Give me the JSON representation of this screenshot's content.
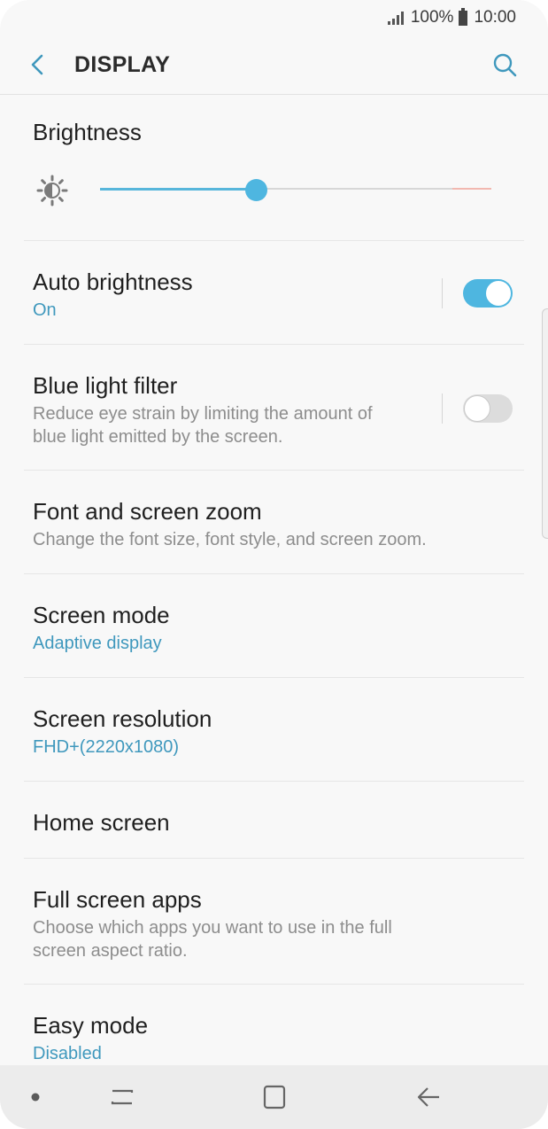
{
  "status_bar": {
    "battery_percent": "100%",
    "time": "10:00"
  },
  "header": {
    "title": "DISPLAY"
  },
  "brightness": {
    "title": "Brightness",
    "level": 0.4
  },
  "settings": {
    "auto_brightness": {
      "title": "Auto brightness",
      "value": "On",
      "enabled": true
    },
    "blue_light_filter": {
      "title": "Blue light filter",
      "description_line1": "Reduce eye strain by limiting the amount of",
      "description_line2": "blue light emitted by the screen.",
      "enabled": false
    },
    "font_zoom": {
      "title": "Font and screen zoom",
      "description": "Change the font size, font style, and screen zoom."
    },
    "screen_mode": {
      "title": "Screen mode",
      "value": "Adaptive display"
    },
    "screen_resolution": {
      "title": "Screen resolution",
      "value": "FHD+(2220x1080)"
    },
    "home_screen": {
      "title": "Home screen"
    },
    "full_screen_apps": {
      "title": "Full screen apps",
      "description_line1": "Choose which apps you want to use in the full",
      "description_line2": "screen aspect ratio."
    },
    "easy_mode": {
      "title": "Easy mode",
      "value": "Disabled"
    }
  },
  "colors": {
    "accent": "#4eb6e0",
    "subtext_blue": "#3f98bd"
  },
  "icons": [
    "signal-icon",
    "battery-icon",
    "back-arrow-icon",
    "search-icon",
    "brightness-sun-icon",
    "dot-icon",
    "recents-icon",
    "home-icon",
    "nav-back-icon"
  ]
}
